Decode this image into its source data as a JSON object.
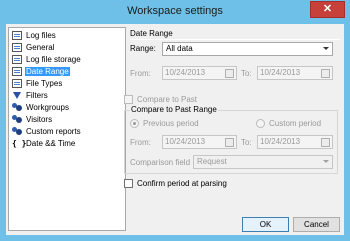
{
  "window": {
    "title": "Workspace settings",
    "close_glyph": "✕"
  },
  "tree": {
    "items": [
      {
        "label": "Log files",
        "icon": "log-files-icon"
      },
      {
        "label": "General",
        "icon": "general-icon"
      },
      {
        "label": "Log file storage",
        "icon": "storage-icon"
      },
      {
        "label": "Date Range",
        "icon": "date-range-icon",
        "selected": true
      },
      {
        "label": "File Types",
        "icon": "file-types-icon"
      },
      {
        "label": "Filters",
        "icon": "filter-icon"
      },
      {
        "label": "Workgroups",
        "icon": "workgroups-icon"
      },
      {
        "label": "Visitors",
        "icon": "visitors-icon"
      },
      {
        "label": "Custom reports",
        "icon": "custom-reports-icon"
      },
      {
        "label": "Date && Time",
        "icon": "braces-icon",
        "glyph": "{ }"
      }
    ]
  },
  "date_range": {
    "section_title": "Date Range",
    "range_label": "Range:",
    "range_value": "All data",
    "from_label": "From:",
    "from_value": "10/24/2013",
    "to_label": "To:",
    "to_value": "10/24/2013"
  },
  "compare": {
    "checkbox_label": "Compare to Past",
    "group_title": "Compare to Past Range",
    "previous_period": "Previous period",
    "custom_period": "Custom period",
    "from_label": "From:",
    "from_value": "10/24/2013",
    "to_label": "To:",
    "to_value": "10/24/2013",
    "comparison_field_label": "Comparison field",
    "comparison_field_value": "Request"
  },
  "confirm": {
    "label": "Confirm period at parsing"
  },
  "buttons": {
    "ok": "OK",
    "cancel": "Cancel"
  },
  "colors": {
    "frame": "#6fc0e8",
    "selection": "#3399ff",
    "close": "#c7403a"
  }
}
